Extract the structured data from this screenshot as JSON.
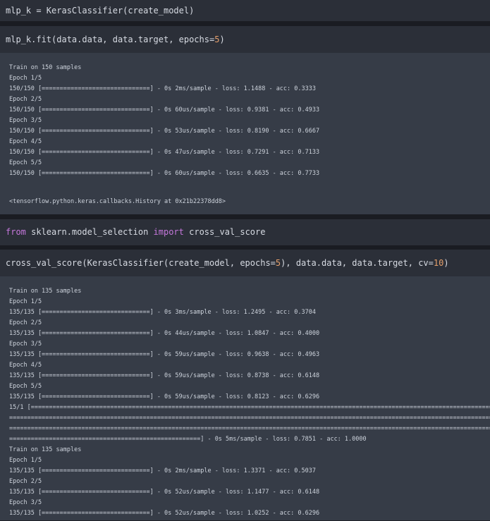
{
  "cells": {
    "c1": {
      "code": "mlp_k = KerasClassifier(create_model)"
    },
    "c2": {
      "code_prefix": "mlp_k.fit(data.data, data.target, epochs=",
      "code_num": "5",
      "code_suffix": ")"
    },
    "out2": {
      "lines": [
        "Train on 150 samples",
        "Epoch 1/5",
        "150/150 [==============================] - 0s 2ms/sample - loss: 1.1488 - acc: 0.3333",
        "Epoch 2/5",
        "150/150 [==============================] - 0s 60us/sample - loss: 0.9381 - acc: 0.4933",
        "Epoch 3/5",
        "150/150 [==============================] - 0s 53us/sample - loss: 0.8190 - acc: 0.6667",
        "Epoch 4/5",
        "150/150 [==============================] - 0s 47us/sample - loss: 0.7291 - acc: 0.7133",
        "Epoch 5/5",
        "150/150 [==============================] - 0s 60us/sample - loss: 0.6635 - acc: 0.7733"
      ],
      "result": "<tensorflow.python.keras.callbacks.History at 0x21b22378dd8>"
    },
    "c3": {
      "kw1": "from",
      "mid": " sklearn.model_selection ",
      "kw2": "import",
      "tail": " cross_val_score"
    },
    "c4": {
      "p1": "cross_val_score(KerasClassifier(create_model, epochs=",
      "n1": "5",
      "p2": "), data.data, data.target, cv=",
      "n2": "10",
      "p3": ")"
    },
    "out4": {
      "lines": [
        "Train on 135 samples",
        "Epoch 1/5",
        "135/135 [==============================] - 0s 3ms/sample - loss: 1.2495 - acc: 0.3704",
        "Epoch 2/5",
        "135/135 [==============================] - 0s 44us/sample - loss: 1.0847 - acc: 0.4000",
        "Epoch 3/5",
        "135/135 [==============================] - 0s 59us/sample - loss: 0.9638 - acc: 0.4963",
        "Epoch 4/5",
        "135/135 [==============================] - 0s 59us/sample - loss: 0.8738 - acc: 0.6148",
        "Epoch 5/5",
        "135/135 [==============================] - 0s 59us/sample - loss: 0.8123 - acc: 0.6296",
        "15/1 [=======================================================================================================================================================",
        "=======================================================================================================================================================",
        "=======================================================================================================================================================",
        "=====================================================] - 0s 5ms/sample - loss: 0.7851 - acc: 1.0000",
        "Train on 135 samples",
        "Epoch 1/5",
        "135/135 [==============================] - 0s 2ms/sample - loss: 1.3371 - acc: 0.5037",
        "Epoch 2/5",
        "135/135 [==============================] - 0s 52us/sample - loss: 1.1477 - acc: 0.6148",
        "Epoch 3/5",
        "135/135 [==============================] - 0s 52us/sample - loss: 1.0252 - acc: 0.6296"
      ]
    }
  },
  "colors": {
    "keyword": "#c678dd",
    "number": "#e5a06c",
    "input_bg": "#2b2f38",
    "output_bg": "#363c47"
  }
}
